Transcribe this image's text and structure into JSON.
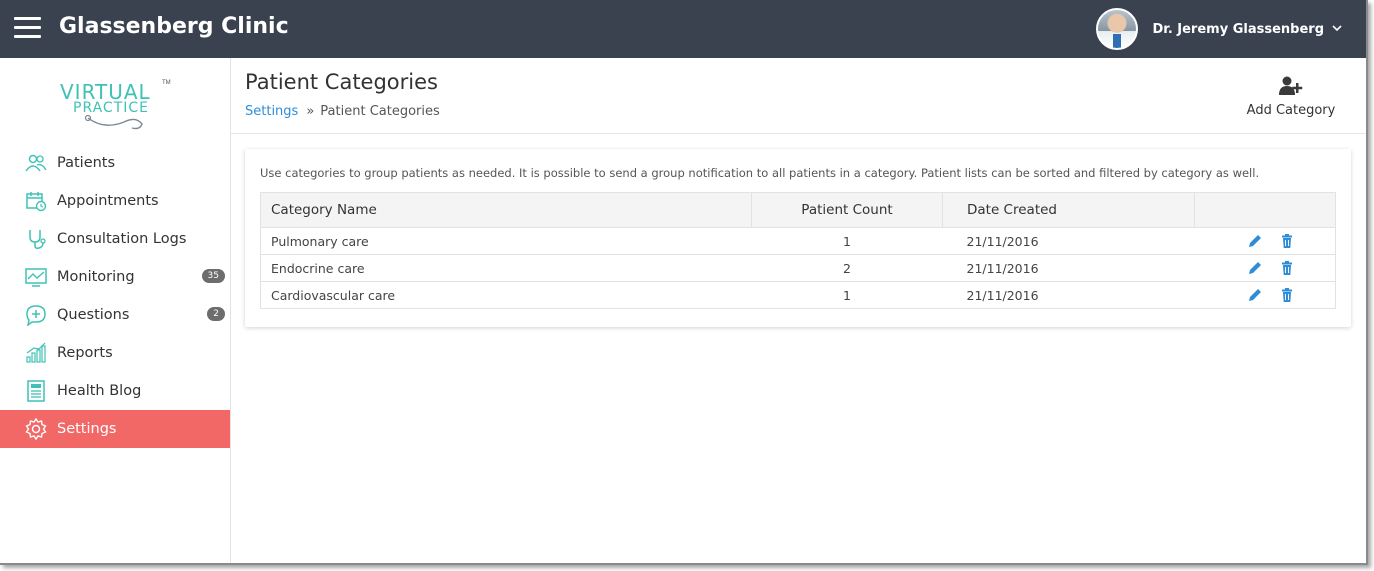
{
  "header": {
    "app_title": "Glassenberg Clinic",
    "user_name": "Dr. Jeremy Glassenberg"
  },
  "logo": {
    "line1": "VIRTUAL",
    "line2": "PRACTICE",
    "tm": "TM"
  },
  "sidebar": {
    "items": [
      {
        "label": "Patients",
        "icon": "patients-icon"
      },
      {
        "label": "Appointments",
        "icon": "calendar-icon"
      },
      {
        "label": "Consultation Logs",
        "icon": "stethoscope-icon"
      },
      {
        "label": "Monitoring",
        "icon": "chart-monitor-icon",
        "badge": "35"
      },
      {
        "label": "Questions",
        "icon": "question-bubble-icon",
        "badge": "2"
      },
      {
        "label": "Reports",
        "icon": "bar-chart-icon"
      },
      {
        "label": "Health Blog",
        "icon": "document-icon"
      },
      {
        "label": "Settings",
        "icon": "gear-icon",
        "active": true
      }
    ]
  },
  "page": {
    "title": "Patient Categories",
    "breadcrumb_parent": "Settings",
    "breadcrumb_sep": "»",
    "breadcrumb_current": "Patient Categories",
    "add_button_label": "Add Category",
    "description": "Use categories to group patients as needed. It is possible to send a group notification to all patients in a category. Patient lists can be sorted and filtered by category as well."
  },
  "table": {
    "columns": [
      "Category Name",
      "Patient Count",
      "Date Created"
    ],
    "rows": [
      {
        "name": "Pulmonary care",
        "count": "1",
        "date": "21/11/2016"
      },
      {
        "name": "Endocrine care",
        "count": "2",
        "date": "21/11/2016"
      },
      {
        "name": "Cardiovascular care",
        "count": "1",
        "date": "21/11/2016"
      }
    ]
  },
  "colors": {
    "topbar": "#3a4250",
    "accent_teal": "#3fc2b5",
    "active_nav": "#f16867",
    "link_blue": "#2e8dd8"
  }
}
